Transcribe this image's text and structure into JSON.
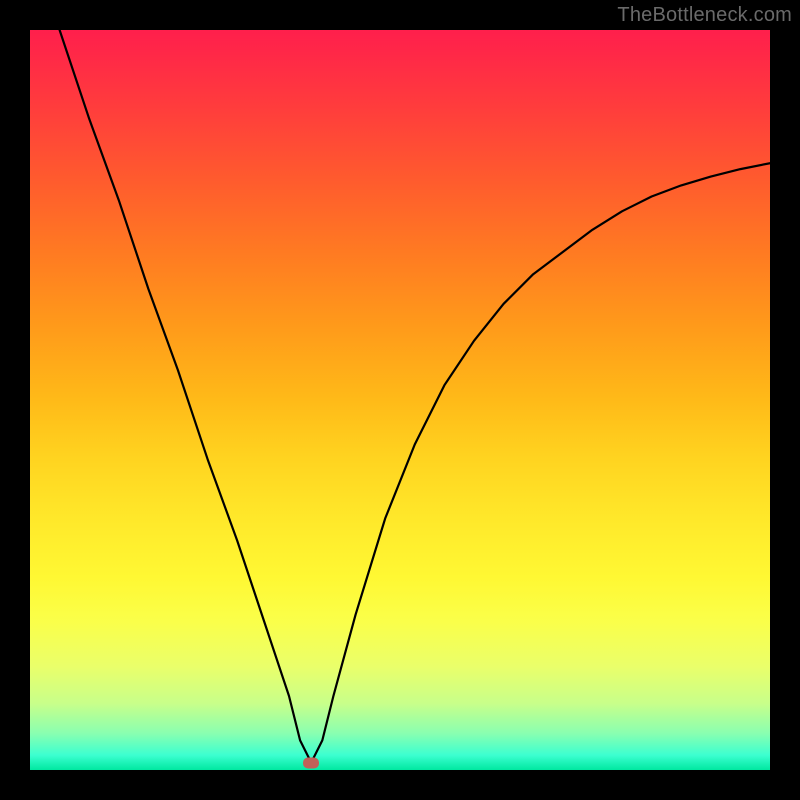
{
  "watermark": "TheBottleneck.com",
  "colors": {
    "curve": "#000000",
    "marker": "#c06058",
    "frame": "#000000"
  },
  "chart_data": {
    "type": "line",
    "title": "",
    "xlabel": "",
    "ylabel": "",
    "xlim": [
      0,
      100
    ],
    "ylim": [
      0,
      100
    ],
    "grid": false,
    "legend": false,
    "minimum": {
      "x": 38,
      "y": 1
    },
    "series": [
      {
        "name": "bottleneck-curve",
        "x": [
          4,
          8,
          12,
          16,
          20,
          24,
          28,
          32,
          35,
          36.5,
          38,
          39.5,
          41,
          44,
          48,
          52,
          56,
          60,
          64,
          68,
          72,
          76,
          80,
          84,
          88,
          92,
          96,
          100
        ],
        "y": [
          100,
          88,
          77,
          65,
          54,
          42,
          31,
          19,
          10,
          4,
          1,
          4,
          10,
          21,
          34,
          44,
          52,
          58,
          63,
          67,
          70,
          73,
          75.5,
          77.5,
          79,
          80.2,
          81.2,
          82
        ]
      }
    ]
  }
}
